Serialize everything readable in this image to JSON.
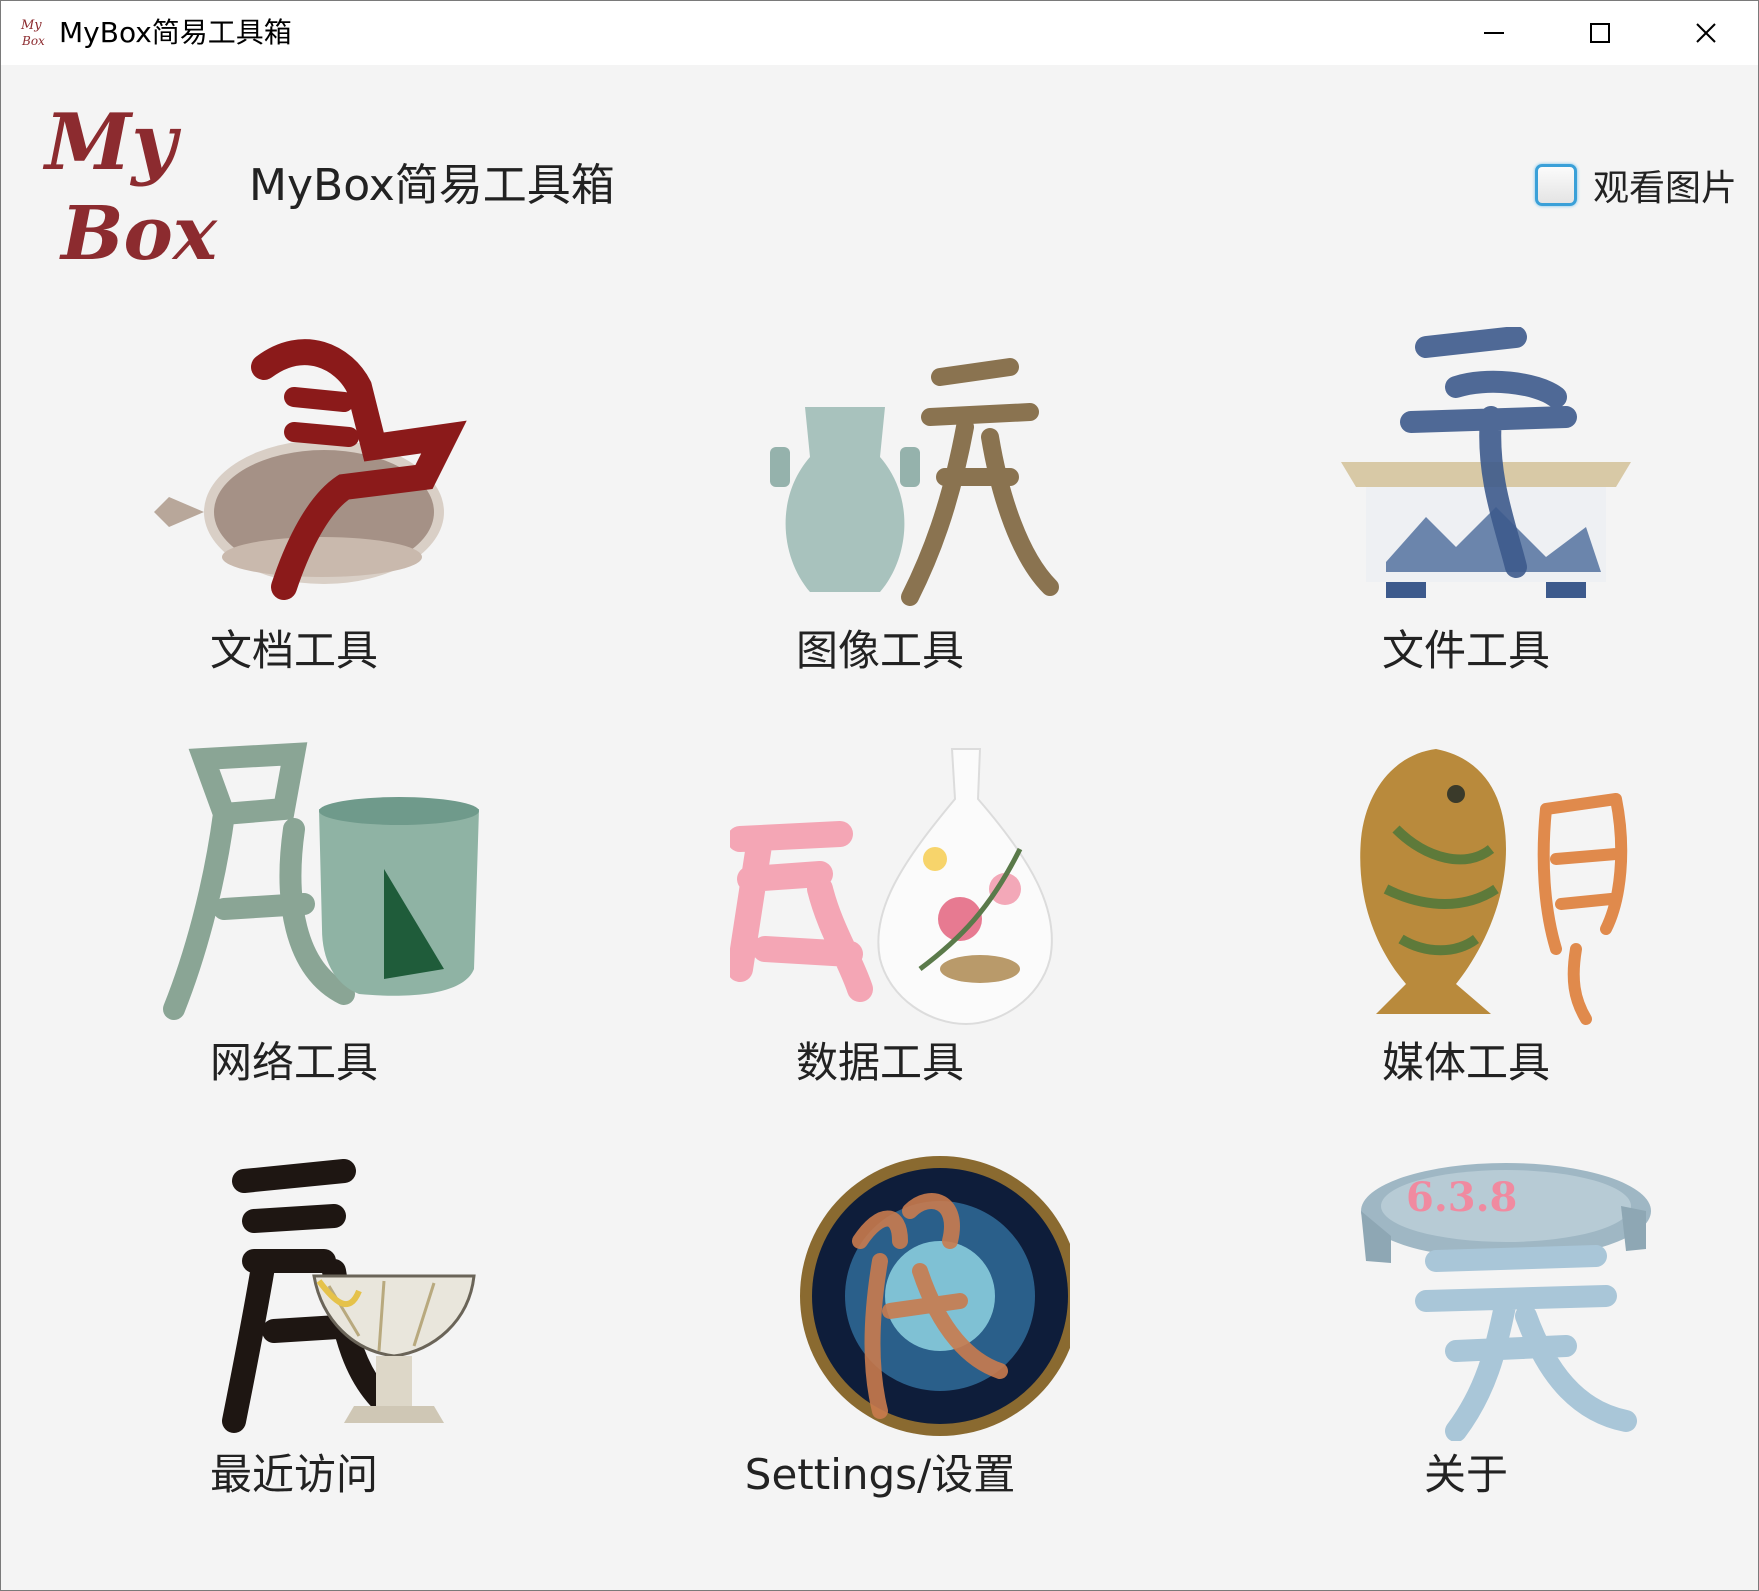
{
  "window": {
    "title": "MyBox简易工具箱",
    "buttons": {
      "minimize": "minimize-icon",
      "maximize": "maximize-icon",
      "close": "close-icon"
    }
  },
  "header": {
    "logo_text": [
      "My",
      "Box"
    ],
    "title": "MyBox简易工具箱",
    "view_images_label": "观看图片",
    "view_images_checked": false
  },
  "tools": [
    {
      "label": "文档工具",
      "icon": "porcelain-ewer-icon",
      "accent": "#8b1a1a"
    },
    {
      "label": "图像工具",
      "icon": "celadon-vase-icon",
      "accent": "#8a7350"
    },
    {
      "label": "文件工具",
      "icon": "blue-white-planter-icon",
      "accent": "#3d5a8c"
    },
    {
      "label": "网络工具",
      "icon": "celadon-jar-icon",
      "accent": "#8aa595"
    },
    {
      "label": "数据工具",
      "icon": "famille-rose-vase-icon",
      "accent": "#f4a6b5"
    },
    {
      "label": "媒体工具",
      "icon": "fish-vase-icon",
      "accent": "#e08a4c"
    },
    {
      "label": "最近访问",
      "icon": "crackle-stem-cup-icon",
      "accent": "#1e1612"
    },
    {
      "label": "Settings/设置",
      "icon": "tenmoku-bowl-icon",
      "accent": "#2a5f8a"
    },
    {
      "label": "关于",
      "icon": "ru-ware-dish-icon",
      "accent": "#a9c6d8",
      "version": "6.3.8"
    }
  ],
  "colors": {
    "background": "#f4f4f4",
    "titlebar": "#ffffff",
    "logo": "#8c2b2f",
    "checkbox_border": "#3aa0d8"
  }
}
